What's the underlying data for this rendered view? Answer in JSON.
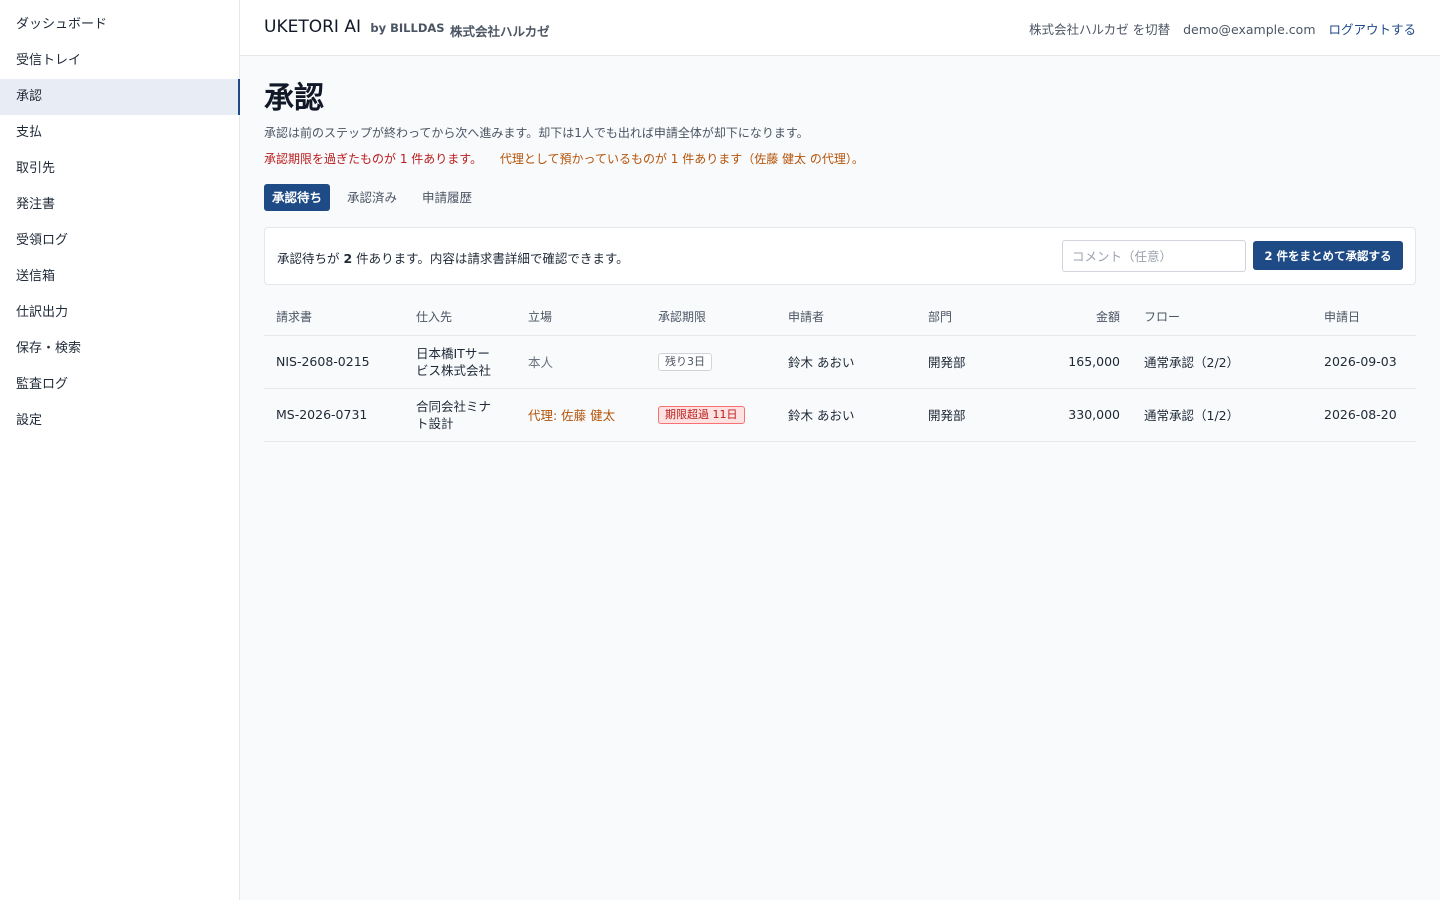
{
  "sidebar": {
    "items": [
      {
        "label": "ダッシュボード"
      },
      {
        "label": "受信トレイ"
      },
      {
        "label": "承認"
      },
      {
        "label": "支払"
      },
      {
        "label": "取引先"
      },
      {
        "label": "発注書"
      },
      {
        "label": "受領ログ"
      },
      {
        "label": "送信箱"
      },
      {
        "label": "仕訳出力"
      },
      {
        "label": "保存・検索"
      },
      {
        "label": "監査ログ"
      },
      {
        "label": "設定"
      }
    ],
    "active": "承認"
  },
  "header": {
    "brand": "UKETORI AI",
    "brand_by": "by BILLDAS",
    "company": "株式会社ハルカゼ",
    "switch_label": "株式会社ハルカゼ を切替",
    "email": "demo@example.com",
    "logout_label": "ログアウトする"
  },
  "page": {
    "title": "承認",
    "description": "承認は前のステップが終わってから次へ進みます。却下は1人でも出れば申請全体が却下になります。",
    "warning_overdue": "承認期限を過ぎたものが 1 件あります。",
    "warning_proxy": "代理として預かっているものが 1 件あります（佐藤 健太 の代理）。"
  },
  "tabs": [
    {
      "label": "承認待ち",
      "active": true
    },
    {
      "label": "承認済み",
      "active": false
    },
    {
      "label": "申請履歴",
      "active": false
    }
  ],
  "panel": {
    "text_prefix": "承認待ちが ",
    "count": "2",
    "text_suffix": " 件あります。内容は請求書詳細で確認できます。",
    "comment_placeholder": "コメント（任意）",
    "bulk_button": "2 件をまとめて承認する"
  },
  "table": {
    "headers": {
      "invoice": "請求書",
      "supplier": "仕入先",
      "role": "立場",
      "deadline": "承認期限",
      "applicant": "申請者",
      "department": "部門",
      "amount": "金額",
      "flow": "フロー",
      "date": "申請日"
    },
    "rows": [
      {
        "invoice": "NIS-2608-0215",
        "supplier_line1": "日本橋ITサー",
        "supplier_line2": "ビス株式会社",
        "role": "本人",
        "deadline": "残り3日",
        "applicant": "鈴木 あおい",
        "department": "開発部",
        "amount": "165,000",
        "flow": "通常承認（2/2）",
        "date": "2026-09-03"
      },
      {
        "invoice": "MS-2026-0731",
        "supplier_line1": "合同会社ミナ",
        "supplier_line2": "ト設計",
        "role": "代理: 佐藤 健太",
        "deadline": "期限超過 11日",
        "applicant": "鈴木 あおい",
        "department": "開発部",
        "amount": "330,000",
        "flow": "通常承認（1/2）",
        "date": "2026-08-20"
      }
    ]
  },
  "colors": {
    "primary": "#1e4a86",
    "warning_red": "#b91c1c",
    "warning_orange": "#b45309",
    "background": "#f8fafc"
  }
}
